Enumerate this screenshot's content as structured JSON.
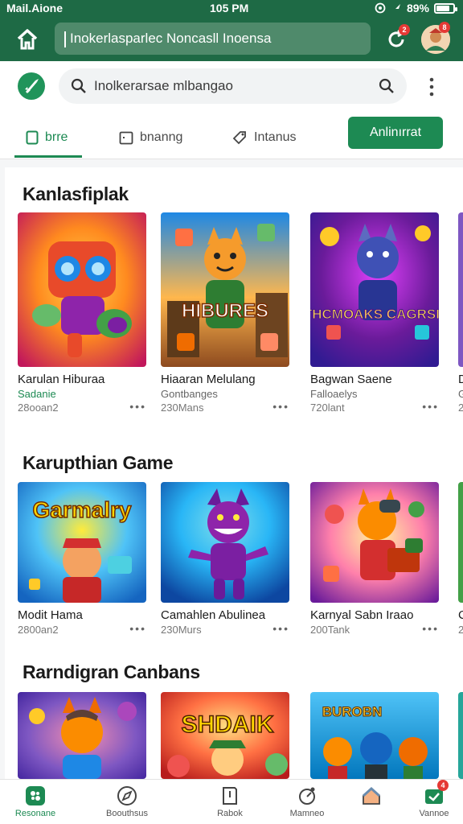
{
  "status_bar": {
    "carrier": "Mail.Aione",
    "time": "105 PM",
    "battery": "89%",
    "battery_level": 0.89
  },
  "browser": {
    "url": "Inokerlasparlec Noncasll Inoensa",
    "tabs_badge": "2",
    "profile_badge": "8"
  },
  "header": {
    "search_text": "Inolkerarsae mlbangao",
    "tabs": [
      {
        "label": "brre",
        "icon": "square-outline-icon"
      },
      {
        "label": "bnanng",
        "icon": "calendar-icon"
      },
      {
        "label": "Intanus",
        "icon": "tag-icon"
      }
    ],
    "apply_label": "Anlinırrat"
  },
  "sections": [
    {
      "title": "Kanlasfiplak",
      "cards": [
        {
          "title": "Karulan Hiburaa",
          "sub": "Sadanie",
          "sub_green": true,
          "meta": "28ooan2",
          "art": "robot",
          "art_text": ""
        },
        {
          "title": "Hiaaran Melulang",
          "sub": "Gontbanges",
          "sub_green": false,
          "meta": "230Mans",
          "art": "fox",
          "art_text": "HIBURES"
        },
        {
          "title": "Bagwan Saene",
          "sub": "Falloaelys",
          "sub_green": false,
          "meta": "720lant",
          "art": "wolf",
          "art_text": "THCMOAKS CAGRSIO"
        },
        {
          "title": "D",
          "sub": "G",
          "sub_green": false,
          "meta": "2",
          "art": "peek",
          "art_text": ""
        }
      ]
    },
    {
      "title": "Karupthian Game",
      "cards": [
        {
          "title": "Modit Hama",
          "sub": "",
          "sub_green": false,
          "meta": "2800an2",
          "art": "sunburst",
          "art_text": "Garmalry"
        },
        {
          "title": "Camahlen Abulinea",
          "sub": "",
          "sub_green": false,
          "meta": "230Murs",
          "art": "monster",
          "art_text": ""
        },
        {
          "title": "Karnyal Sabn Iraao",
          "sub": "",
          "sub_green": false,
          "meta": "200Tank",
          "art": "fox2",
          "art_text": ""
        },
        {
          "title": "C",
          "sub": "",
          "sub_green": false,
          "meta": "2",
          "art": "peek",
          "art_text": ""
        }
      ]
    },
    {
      "title": "Rarndigran Canbans",
      "cards": [
        {
          "title": "",
          "sub": "",
          "sub_green": false,
          "meta": "",
          "art": "fox3",
          "art_text": ""
        },
        {
          "title": "",
          "sub": "",
          "sub_green": false,
          "meta": "",
          "art": "shdaik",
          "art_text": "SHDAIK"
        },
        {
          "title": "",
          "sub": "",
          "sub_green": false,
          "meta": "",
          "art": "team",
          "art_text": "BUROBN"
        },
        {
          "title": "",
          "sub": "",
          "sub_green": false,
          "meta": "",
          "art": "peek",
          "art_text": ""
        }
      ]
    }
  ],
  "bottom_nav": [
    {
      "label": "Resonane",
      "icon": "games-icon",
      "active": true
    },
    {
      "label": "Boouthsus",
      "icon": "compass-icon",
      "active": false
    },
    {
      "label": "Rabok",
      "icon": "book-icon",
      "active": false
    },
    {
      "label": "Mamneo",
      "icon": "bell-icon",
      "active": false
    },
    {
      "label": "",
      "icon": "house-icon",
      "active": false
    },
    {
      "label": "Vannoe",
      "icon": "apps-icon",
      "active": false,
      "badge": "4"
    }
  ],
  "colors": {
    "brand": "#1e6a45",
    "accent": "#1d8a53",
    "badge": "#e53935"
  }
}
